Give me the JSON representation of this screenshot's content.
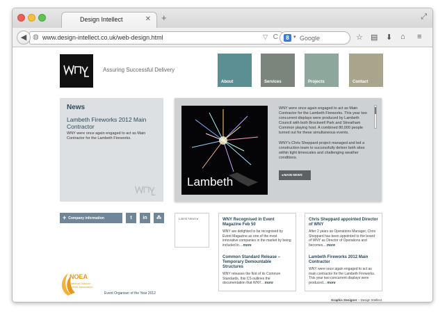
{
  "browser": {
    "tab_title": "Design Intellect",
    "tab_close": "✕",
    "new_tab": "+",
    "url": "www.design-intellect.co.uk/web-design.html",
    "search_engine_label": "8",
    "search_placeholder": "Google"
  },
  "site": {
    "tagline": "Assuring Successful Delivery",
    "nav": [
      {
        "label": "About",
        "color": "#5b8f93"
      },
      {
        "label": "Services",
        "color": "#7b857c"
      },
      {
        "label": "Projects",
        "color": "#8ea79c"
      },
      {
        "label": "Contact",
        "color": "#a9a58d"
      }
    ],
    "news": {
      "heading": "News",
      "title": "Lambeth Fireworks 2012 Main Contractor",
      "text": "WNY were once again engaged to act as Main Contractor for the Lambeth Fireworks."
    },
    "feature": {
      "image_label": "Lambeth",
      "paragraph1": "WNY were once again engaged to act as Main Contractor for the Lambeth Fireworks. This year two concurrent displays were produced by Lambeth Council with both Brockwell Park and Streatham Common playing host. A combined 80,000 people turned out for these simultaneous events.",
      "paragraph2": "WNY's Chris Sheppard project managed and led a construction team to successfully deliver both sites within tight timescales and challenging weather conditions.",
      "button": "◂  MAIN NEWS"
    },
    "company_button": "Company information",
    "social": {
      "twitter": "t",
      "linkedin": "in",
      "share": "⁂"
    },
    "latest_news_label": "Latest News ▸",
    "cards": [
      {
        "items": [
          {
            "title": "WNY Recognised in Event Magazine Feb 50",
            "text": "WNY are delighted to be recognised by Event Magazine as one of the most innovative companies in the market by being included in...",
            "more": "more"
          },
          {
            "title": "Common Standard Release – Temporary Demountable Structures",
            "text": "WNY releases the first of its Common Standards, this CS outlines the documentation that WNY...",
            "more": "more"
          }
        ]
      },
      {
        "items": [
          {
            "title": "Chris Sheppard appointed Director of WNY",
            "text": "After 2 years as Operations Manager, Chris Sheppard has been appointed to the board of WNY as Director of Operations and becomes...",
            "more": "more"
          },
          {
            "title": "Lambeth Fireworks 2012 Main Contractor",
            "text": "WNY were once again engaged to act as main contractor for the Lambeth Fireworks. This year two concurrent displays were produced...",
            "more": "more"
          }
        ]
      }
    ],
    "noea": {
      "name": "NOEA",
      "sub": "National Outdoor Events Association"
    },
    "award": "Event Organiser of the Year 2012",
    "footer_left": "Graphic Designer",
    "footer_sep": " – ",
    "footer_right": "Design Intellect"
  }
}
